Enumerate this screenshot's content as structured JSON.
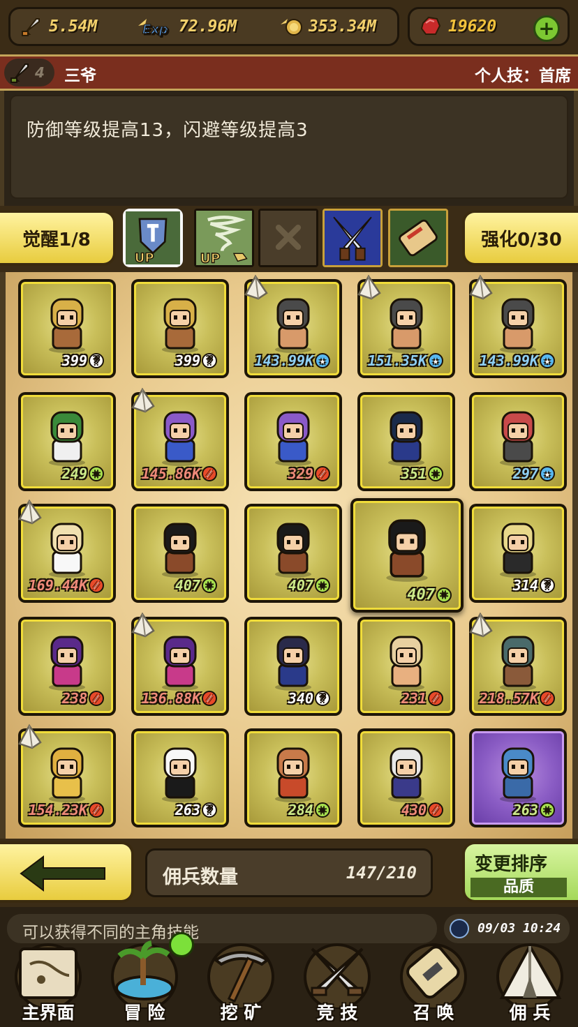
{
  "resources": {
    "attack": "5.54M",
    "exp_icon_text": "Exp",
    "exp": "72.96M",
    "gold": "353.34M",
    "gems": "19620"
  },
  "character": {
    "level": "4",
    "name": "三爷",
    "skill": "个人技：首席"
  },
  "description": "防御等级提高13，闪避等级提高3",
  "skill_bar": {
    "awaken": "觉醒1/8",
    "enhance": "强化0/30",
    "up_text": "UP"
  },
  "cards": [
    {
      "value": "399",
      "kind": "q",
      "color": "white"
    },
    {
      "value": "399",
      "kind": "q",
      "color": "white"
    },
    {
      "value": "143.99K",
      "kind": "star",
      "color": "blue",
      "tag": true
    },
    {
      "value": "151.35K",
      "kind": "star",
      "color": "blue",
      "tag": true
    },
    {
      "value": "143.99K",
      "kind": "star",
      "color": "blue",
      "tag": true
    },
    {
      "value": "249",
      "kind": "plus",
      "color": "green"
    },
    {
      "value": "145.86K",
      "kind": "slash",
      "color": "red",
      "tag": true
    },
    {
      "value": "329",
      "kind": "slash",
      "color": "red"
    },
    {
      "value": "351",
      "kind": "plus",
      "color": "green"
    },
    {
      "value": "297",
      "kind": "star",
      "color": "blue"
    },
    {
      "value": "169.44K",
      "kind": "slash",
      "color": "red",
      "tag": true
    },
    {
      "value": "407",
      "kind": "plus",
      "color": "green"
    },
    {
      "value": "407",
      "kind": "plus",
      "color": "green"
    },
    {
      "value": "407",
      "kind": "plus",
      "color": "green",
      "selected": true
    },
    {
      "value": "314",
      "kind": "q",
      "color": "white"
    },
    {
      "value": "238",
      "kind": "slash",
      "color": "red"
    },
    {
      "value": "136.88K",
      "kind": "slash",
      "color": "red",
      "tag": true
    },
    {
      "value": "340",
      "kind": "q",
      "color": "white"
    },
    {
      "value": "231",
      "kind": "slash",
      "color": "red"
    },
    {
      "value": "218.57K",
      "kind": "slash",
      "color": "red",
      "tag": true
    },
    {
      "value": "154.23K",
      "kind": "slash",
      "color": "red",
      "tag": true
    },
    {
      "value": "263",
      "kind": "q",
      "color": "white"
    },
    {
      "value": "284",
      "kind": "plus",
      "color": "green"
    },
    {
      "value": "430",
      "kind": "slash",
      "color": "red"
    },
    {
      "value": "263",
      "kind": "plus",
      "color": "green",
      "purple": true
    }
  ],
  "mercenary": {
    "label": "佣兵数量",
    "count": "147/210"
  },
  "sort": {
    "title": "变更排序",
    "mode": "品质"
  },
  "tip": "可以获得不同的主角技能",
  "time": "09/03 10:24",
  "nav": [
    {
      "label": "主界面",
      "icon": "map-scroll-icon"
    },
    {
      "label": "冒 险",
      "icon": "island-icon"
    },
    {
      "label": "挖 矿",
      "icon": "pickaxe-icon"
    },
    {
      "label": "竞 技",
      "icon": "crossed-swords-icon"
    },
    {
      "label": "召 唤",
      "icon": "summon-scroll-icon"
    },
    {
      "label": "佣 兵",
      "icon": "tent-icon"
    }
  ],
  "colors": {
    "accent_yellow": "#e8cc3e",
    "name_bar": "#7a2e1e",
    "card_border": "#f0dc3a",
    "sort_green": "#a4d85a"
  }
}
